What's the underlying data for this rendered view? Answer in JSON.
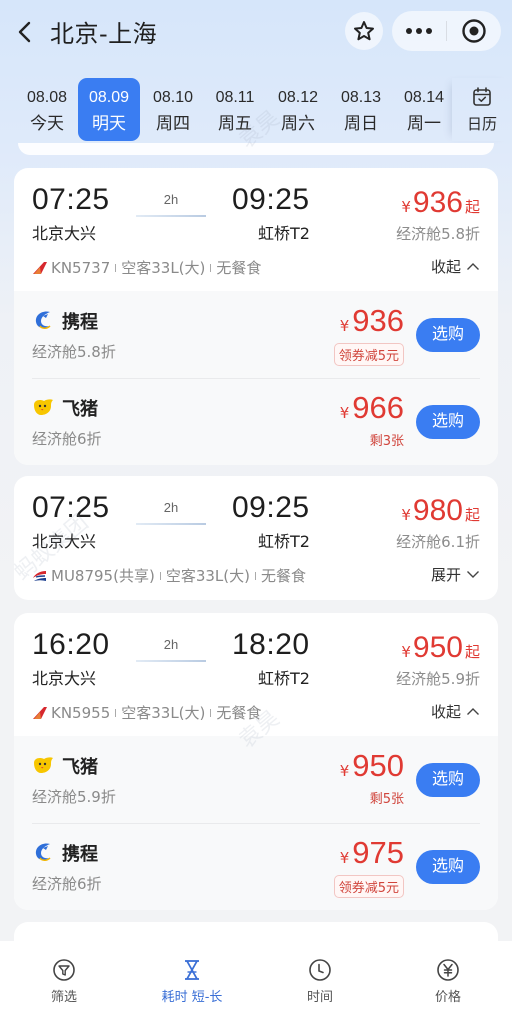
{
  "header": {
    "title": "北京-上海",
    "icons": {
      "back": "chevron-left-icon",
      "star": "star-icon",
      "more": "more-dots-icon",
      "close": "target-circle-icon"
    }
  },
  "dates": [
    {
      "date": "08.08",
      "weekday": "今天",
      "active": false
    },
    {
      "date": "08.09",
      "weekday": "明天",
      "active": true
    },
    {
      "date": "08.10",
      "weekday": "周四",
      "active": false
    },
    {
      "date": "08.11",
      "weekday": "周五",
      "active": false
    },
    {
      "date": "08.12",
      "weekday": "周六",
      "active": false
    },
    {
      "date": "08.13",
      "weekday": "周日",
      "active": false
    },
    {
      "date": "08.14",
      "weekday": "周一",
      "active": false
    }
  ],
  "calendar": {
    "label": "日历",
    "icon": "calendar-check-icon"
  },
  "currency": "¥",
  "from_suffix": "起",
  "flights": [
    {
      "dep_time": "07:25",
      "dep_airport": "北京大兴",
      "arr_time": "09:25",
      "arr_airport": "虹桥T2",
      "duration": "2h",
      "price": "936",
      "discount": "经济舱5.8折",
      "flight_no": "KN5737",
      "aircraft": "空客33L(大)",
      "meal": "无餐食",
      "airline_logo": "china-united-airlines-logo",
      "toggle": "收起",
      "expanded": true,
      "vendors": [
        {
          "name": "携程",
          "logo": "ctrip-dolphin-logo",
          "discount": "经济舱5.8折",
          "price": "936",
          "note": "领券减5元",
          "note_type": "badge",
          "button": "选购"
        },
        {
          "name": "飞猪",
          "logo": "fliggy-logo",
          "discount": "经济舱6折",
          "price": "966",
          "note": "剩3张",
          "note_type": "text",
          "button": "选购"
        }
      ]
    },
    {
      "dep_time": "07:25",
      "dep_airport": "北京大兴",
      "arr_time": "09:25",
      "arr_airport": "虹桥T2",
      "duration": "2h",
      "price": "980",
      "discount": "经济舱6.1折",
      "flight_no": "MU8795(共享)",
      "aircraft": "空客33L(大)",
      "meal": "无餐食",
      "airline_logo": "china-eastern-logo",
      "toggle": "展开",
      "expanded": false,
      "vendors": []
    },
    {
      "dep_time": "16:20",
      "dep_airport": "北京大兴",
      "arr_time": "18:20",
      "arr_airport": "虹桥T2",
      "duration": "2h",
      "price": "950",
      "discount": "经济舱5.9折",
      "flight_no": "KN5955",
      "aircraft": "空客33L(大)",
      "meal": "无餐食",
      "airline_logo": "china-united-airlines-logo",
      "toggle": "收起",
      "expanded": true,
      "vendors": [
        {
          "name": "飞猪",
          "logo": "fliggy-logo",
          "discount": "经济舱5.9折",
          "price": "950",
          "note": "剩5张",
          "note_type": "text",
          "button": "选购"
        },
        {
          "name": "携程",
          "logo": "ctrip-dolphin-logo",
          "discount": "经济舱6折",
          "price": "975",
          "note": "领券减5元",
          "note_type": "badge",
          "button": "选购"
        }
      ]
    }
  ],
  "tabbar": [
    {
      "label": "筛选",
      "icon": "filter-icon",
      "active": false
    },
    {
      "label": "耗时 短-长",
      "icon": "hourglass-icon",
      "active": true
    },
    {
      "label": "时间",
      "icon": "clock-icon",
      "active": false
    },
    {
      "label": "价格",
      "icon": "yen-icon",
      "active": false
    }
  ],
  "watermarks": [
    "袁昊",
    "蚂蚁集团"
  ],
  "colors": {
    "accent": "#3a7df2",
    "price": "#e03a33",
    "tab_active": "#3a6fd6"
  }
}
